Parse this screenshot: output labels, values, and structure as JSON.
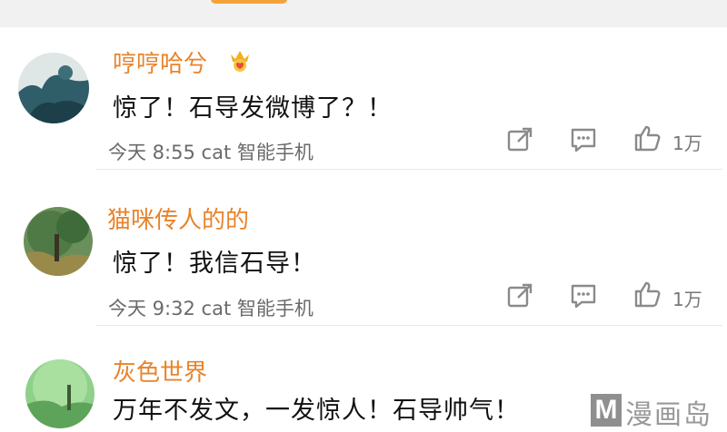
{
  "comments": [
    {
      "username": "哼哼哈兮",
      "badge_icon": "crown-heart-badge-icon",
      "content": "惊了！石导发微博了？！",
      "time": "今天 8:55",
      "device": "cat 智能手机",
      "likes": "1万"
    },
    {
      "username": "猫咪传人的的",
      "content": "惊了！我信石导！",
      "time": "今天 9:32",
      "device": "cat 智能手机",
      "likes": "1万"
    },
    {
      "username": "灰色世界",
      "content": "万年不发文，一发惊人！石导帅气！"
    }
  ],
  "watermark": {
    "logo_letter": "M",
    "text": "漫画岛"
  },
  "colors": {
    "username": "#e8832b",
    "content": "#111111",
    "meta": "#6a6a6a",
    "icon": "#8a8a8a"
  }
}
